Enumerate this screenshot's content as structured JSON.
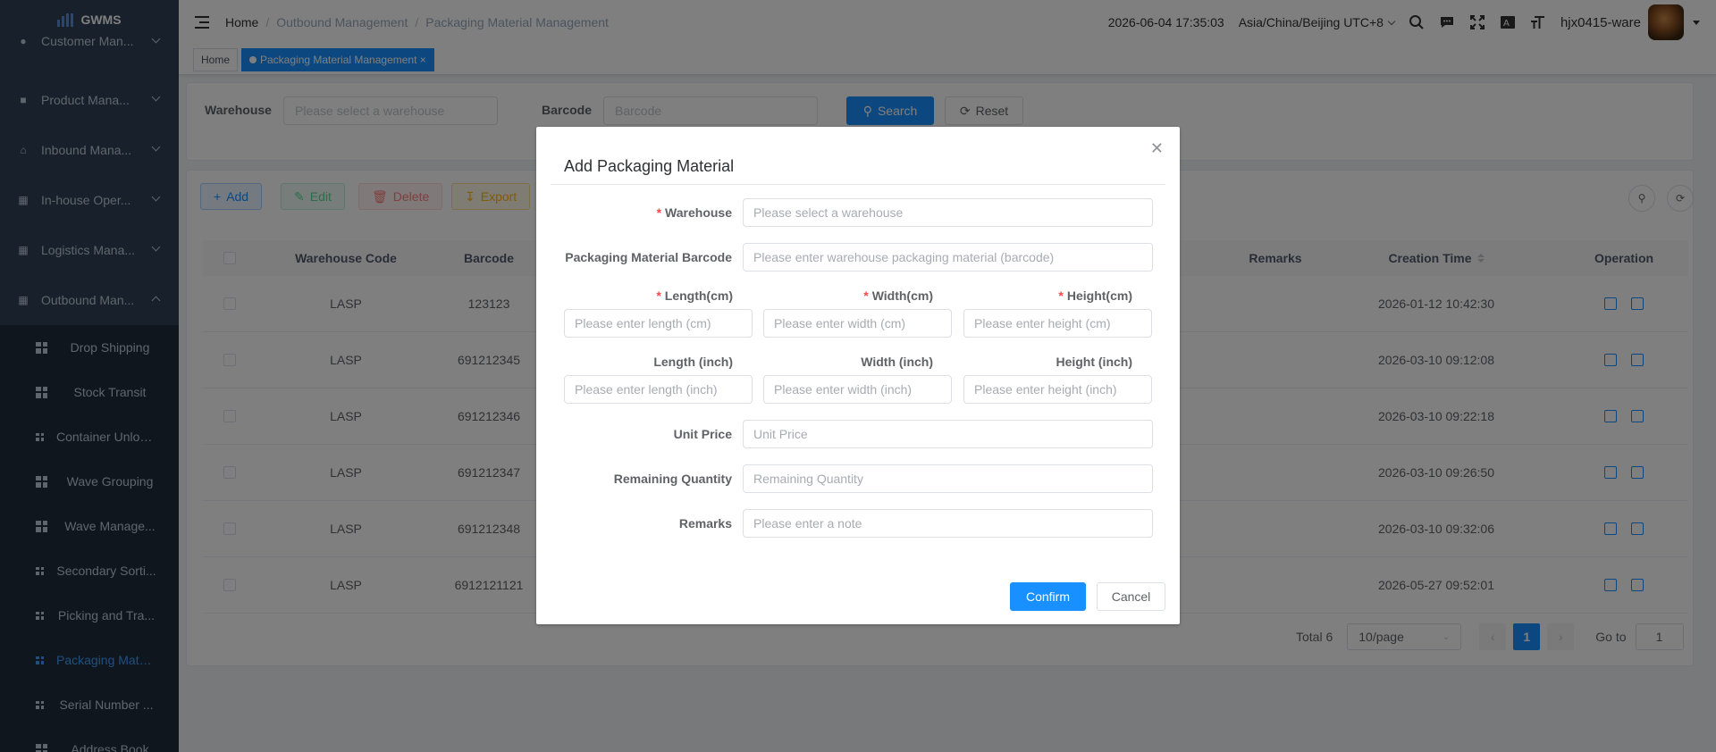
{
  "app": {
    "name": "GWMS"
  },
  "sidebar": {
    "menus": [
      {
        "label": "Customer Man...",
        "icon": "user-icon"
      },
      {
        "label": "Product Mana...",
        "icon": "cart-icon"
      },
      {
        "label": "Inbound Mana...",
        "icon": "home-icon"
      },
      {
        "label": "In-house Oper...",
        "icon": "table-icon"
      },
      {
        "label": "Logistics Mana...",
        "icon": "grid-icon"
      },
      {
        "label": "Outbound Man...",
        "icon": "grid-icon"
      }
    ],
    "submenu": [
      {
        "label": "Drop Shipping"
      },
      {
        "label": "Stock Transit"
      },
      {
        "label": "Container Unloa..."
      },
      {
        "label": "Wave Grouping"
      },
      {
        "label": "Wave Manage..."
      },
      {
        "label": "Secondary Sorti..."
      },
      {
        "label": "Picking and Tra..."
      },
      {
        "label": "Packaging Mate..."
      },
      {
        "label": "Serial Number ..."
      },
      {
        "label": "Address Book"
      }
    ]
  },
  "header": {
    "breadcrumb": [
      "Home",
      "Outbound Management",
      "Packaging Material Management"
    ],
    "datetime": "2026-06-04 17:35:03",
    "timezone": "Asia/China/Beijing UTC+8",
    "username": "hjx0415-ware"
  },
  "tags": {
    "home": "Home",
    "current": "Packaging Material Management"
  },
  "search": {
    "warehouse_label": "Warehouse",
    "warehouse_placeholder": "Please select a warehouse",
    "barcode_label": "Barcode",
    "barcode_placeholder": "Barcode",
    "search_btn": "Search",
    "reset_btn": "Reset"
  },
  "toolbar": {
    "add": "Add",
    "edit": "Edit",
    "delete": "Delete",
    "export": "Export"
  },
  "table": {
    "columns": {
      "warehouse_code": "Warehouse Code",
      "barcode": "Barcode",
      "remarks": "Remarks",
      "creation_time": "Creation Time",
      "operation": "Operation"
    },
    "rows": [
      {
        "warehouse_code": "LASP",
        "barcode": "123123",
        "creation_time": "2026-01-12 10:42:30"
      },
      {
        "warehouse_code": "LASP",
        "barcode": "691212345",
        "creation_time": "2026-03-10 09:12:08"
      },
      {
        "warehouse_code": "LASP",
        "barcode": "691212346",
        "creation_time": "2026-03-10 09:22:18"
      },
      {
        "warehouse_code": "LASP",
        "barcode": "691212347",
        "creation_time": "2026-03-10 09:26:50"
      },
      {
        "warehouse_code": "LASP",
        "barcode": "691212348",
        "creation_time": "2026-03-10 09:32:06"
      },
      {
        "warehouse_code": "LASP",
        "barcode": "6912121121",
        "creation_time": "2026-05-27 09:52:01"
      }
    ]
  },
  "pagination": {
    "total": "Total 6",
    "page_size": "10/page",
    "current_page": "1",
    "goto_label": "Go to",
    "goto_value": "1"
  },
  "dialog": {
    "title": "Add Packaging Material",
    "warehouse_label": "Warehouse",
    "warehouse_placeholder": "Please select a warehouse",
    "barcode_label": "Packaging Material Barcode",
    "barcode_placeholder": "Please enter warehouse packaging material (barcode)",
    "length_cm_label": "Length(cm)",
    "length_cm_placeholder": "Please enter length (cm)",
    "width_cm_label": "Width(cm)",
    "width_cm_placeholder": "Please enter width (cm)",
    "height_cm_label": "Height(cm)",
    "height_cm_placeholder": "Please enter height (cm)",
    "length_in_label": "Length (inch)",
    "length_in_placeholder": "Please enter length (inch)",
    "width_in_label": "Width (inch)",
    "width_in_placeholder": "Please enter width (inch)",
    "height_in_label": "Height (inch)",
    "height_in_placeholder": "Please enter height (inch)",
    "unit_price_label": "Unit Price",
    "unit_price_placeholder": "Unit Price",
    "remaining_label": "Remaining Quantity",
    "remaining_placeholder": "Remaining Quantity",
    "remarks_label": "Remarks",
    "remarks_placeholder": "Please enter a note",
    "confirm": "Confirm",
    "cancel": "Cancel"
  },
  "colors": {
    "primary": "#1890ff",
    "sidebar": "#304156",
    "required": "#ff4949"
  }
}
